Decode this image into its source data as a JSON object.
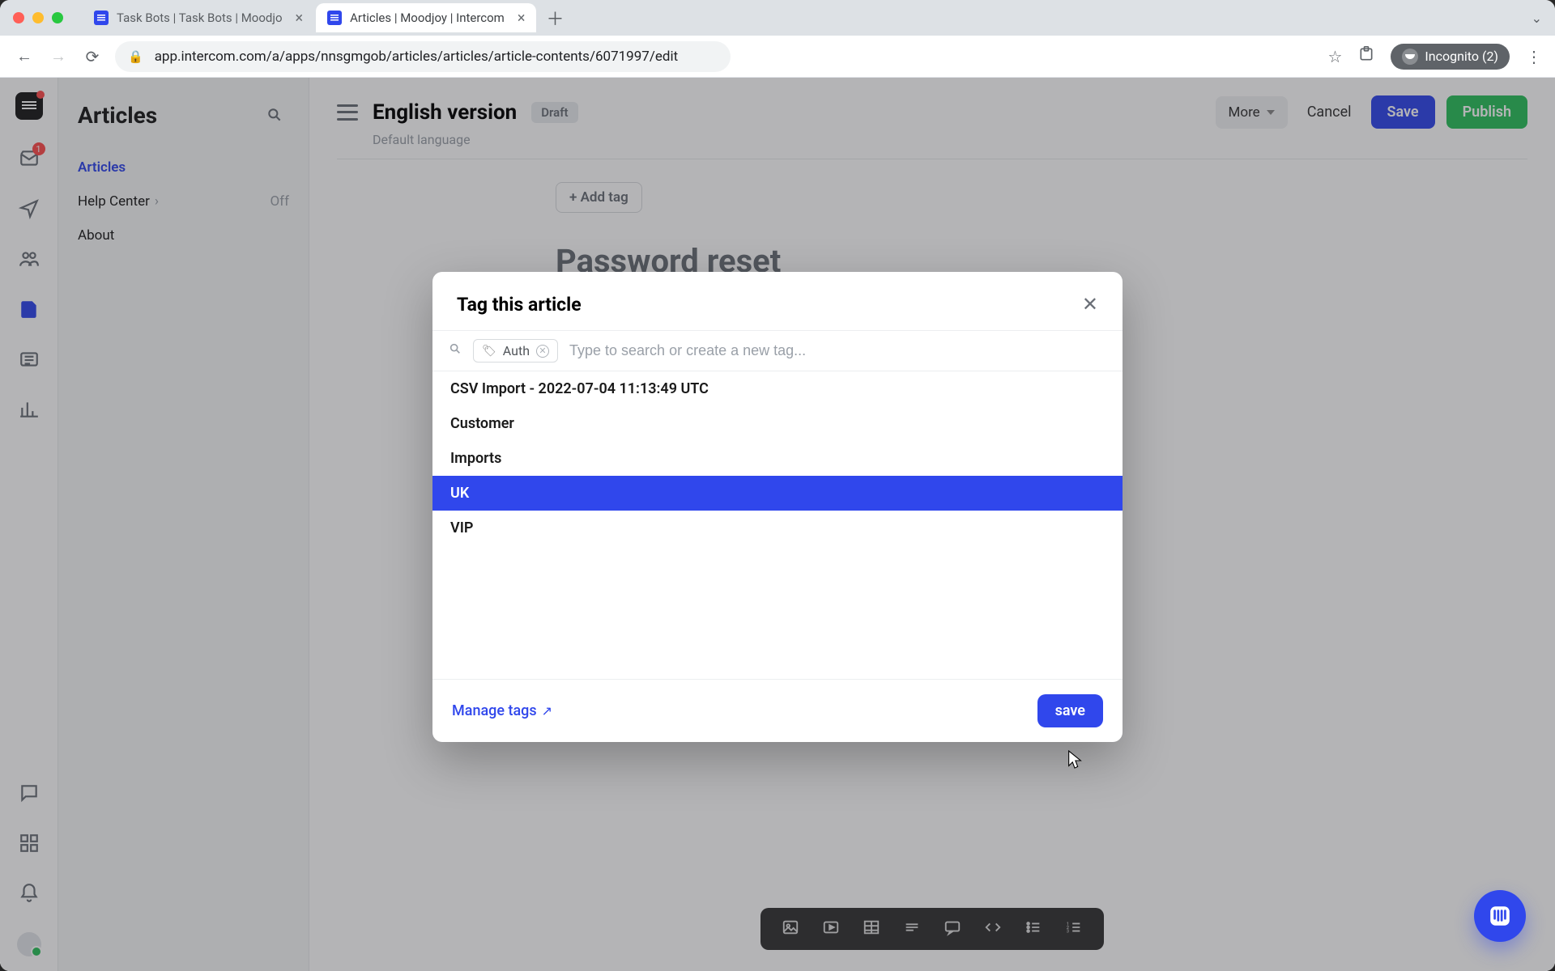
{
  "browser": {
    "tabs": [
      {
        "title": "Task Bots | Task Bots | Moodjo",
        "active": false
      },
      {
        "title": "Articles | Moodjoy | Intercom",
        "active": true
      }
    ],
    "url": "app.intercom.com/a/apps/nnsgmgob/articles/articles/article-contents/6071997/edit",
    "incognito_label": "Incognito (2)"
  },
  "rail": {
    "inbox_badge": "1"
  },
  "sidebar": {
    "title": "Articles",
    "items": {
      "articles": "Articles",
      "help_center": "Help Center",
      "help_center_state": "Off",
      "about": "About"
    }
  },
  "editor": {
    "version_label": "English version",
    "status": "Draft",
    "default_lang": "Default language",
    "more": "More",
    "cancel": "Cancel",
    "save": "Save",
    "publish": "Publish",
    "add_tag": "+ Add tag",
    "article_heading": "Password reset"
  },
  "dialog": {
    "title": "Tag this article",
    "chip_label": "Auth",
    "placeholder": "Type to search or create a new tag...",
    "options": [
      "CSV Import - 2022-07-04 11:13:49 UTC",
      "Customer",
      "Imports",
      "UK",
      "VIP"
    ],
    "highlight_index": 3,
    "manage": "Manage tags",
    "save": "save"
  }
}
